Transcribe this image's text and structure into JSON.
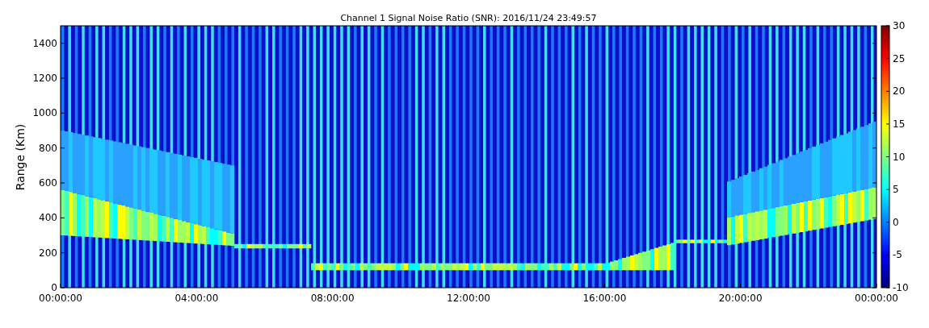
{
  "title": "Channel 1 Signal Noise Ratio (SNR): 2016/11/24 23:49:57",
  "y_label": "Range (Km)",
  "y_ticks": [
    "1400",
    "1200",
    "1000",
    "800",
    "600",
    "400",
    "200",
    "0"
  ],
  "x_ticks": [
    "00:00:00",
    "04:00:00",
    "08:00:00",
    "12:00:00",
    "16:00:00",
    "20:00:00",
    "00:00:00"
  ],
  "colorbar_ticks": [
    "30",
    "25",
    "20",
    "15",
    "10",
    "5",
    "0",
    "-5",
    "-10"
  ]
}
